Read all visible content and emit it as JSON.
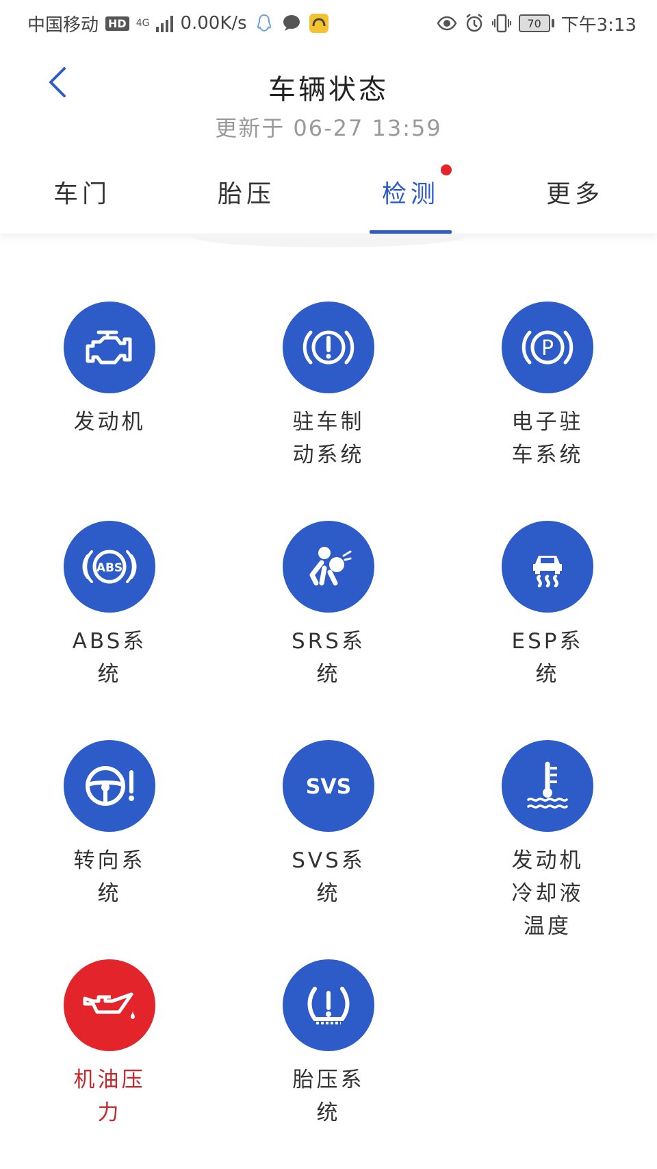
{
  "status_bar": {
    "carrier": "中国移动",
    "hd_badge": "HD",
    "network": "4G",
    "speed": "0.00K/s",
    "battery": "70",
    "time": "下午3:13"
  },
  "header": {
    "title": "车辆状态",
    "updated": "更新于  06-27  13:59"
  },
  "tabs": [
    {
      "label": "车门",
      "active": false
    },
    {
      "label": "胎压",
      "active": false
    },
    {
      "label": "检测",
      "active": true
    },
    {
      "label": "更多",
      "active": false
    }
  ],
  "items": [
    {
      "label": "发动机",
      "icon": "engine-icon",
      "status": "normal"
    },
    {
      "label": "驻车制动系统",
      "icon": "parking-brake-icon",
      "status": "normal"
    },
    {
      "label": "电子驻车系统",
      "icon": "electronic-parking-icon",
      "status": "normal"
    },
    {
      "label": "ABS系统",
      "icon": "abs-icon",
      "status": "normal"
    },
    {
      "label": "SRS系统",
      "icon": "airbag-icon",
      "status": "normal"
    },
    {
      "label": "ESP系统",
      "icon": "esp-icon",
      "status": "normal"
    },
    {
      "label": "转向系统",
      "icon": "steering-icon",
      "status": "normal"
    },
    {
      "label": "SVS系统",
      "icon": "svs-icon",
      "status": "normal"
    },
    {
      "label": "发动机冷却液温度",
      "icon": "coolant-temp-icon",
      "status": "normal"
    },
    {
      "label": "机油压力",
      "icon": "oil-pressure-icon",
      "status": "warning"
    },
    {
      "label": "胎压系统",
      "icon": "tire-pressure-icon",
      "status": "normal"
    }
  ],
  "colors": {
    "accent": "#2d5cc9",
    "warning": "#e3242b",
    "warning_text": "#c9262c",
    "badge": "#e5252a"
  },
  "icon_text": {
    "abs": "ABS",
    "svs": "SVS",
    "parking": "P"
  }
}
